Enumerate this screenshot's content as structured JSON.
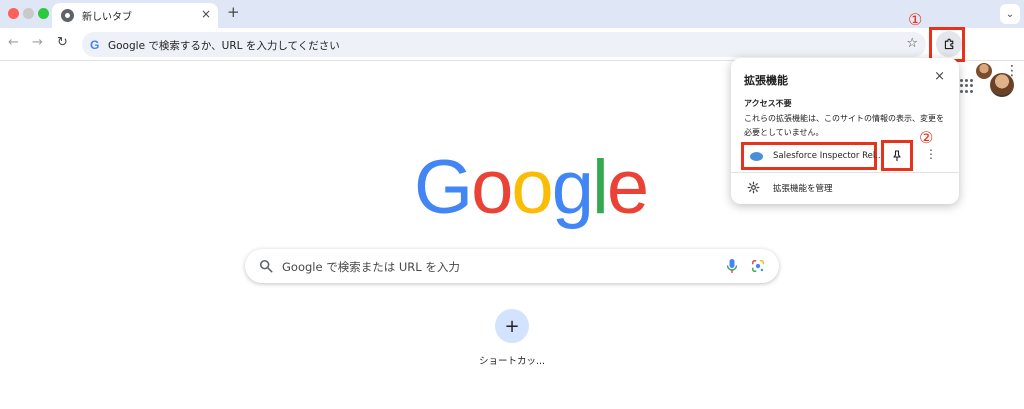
{
  "browser": {
    "tab": {
      "title": "新しいタブ",
      "close": "×"
    },
    "new_tab": "+",
    "tab_menu": "⌄"
  },
  "toolbar": {
    "back": "←",
    "forward": "→",
    "reload": "↻",
    "omnibox_icon": "G",
    "omnibox_placeholder": "Google で検索するか、URL を入力してください",
    "bookmark": "☆",
    "menu": "⋮"
  },
  "annotations": {
    "marker_1": "①",
    "marker_2": "②",
    "highlight_color": "#e8321b"
  },
  "page": {
    "logo_letters": [
      "G",
      "o",
      "o",
      "g",
      "l",
      "e"
    ],
    "search_placeholder": "Google で検索または URL を入力",
    "shortcut_add": "+",
    "shortcut_label": "ショートカッ..."
  },
  "extensions_popup": {
    "title": "拡張機能",
    "close": "×",
    "section_title": "アクセス不要",
    "section_desc": "これらの拡張機能は、このサイトの情報の表示、変更を必要としていません。",
    "extension_name": "Salesforce Inspector Rel...",
    "more": "⋮",
    "manage_label": "拡張機能を管理"
  },
  "colors": {
    "accent_blue": "#4285f4",
    "tabstrip_bg": "#dfe6f5",
    "shortcut_bg": "#d3e3fd"
  }
}
